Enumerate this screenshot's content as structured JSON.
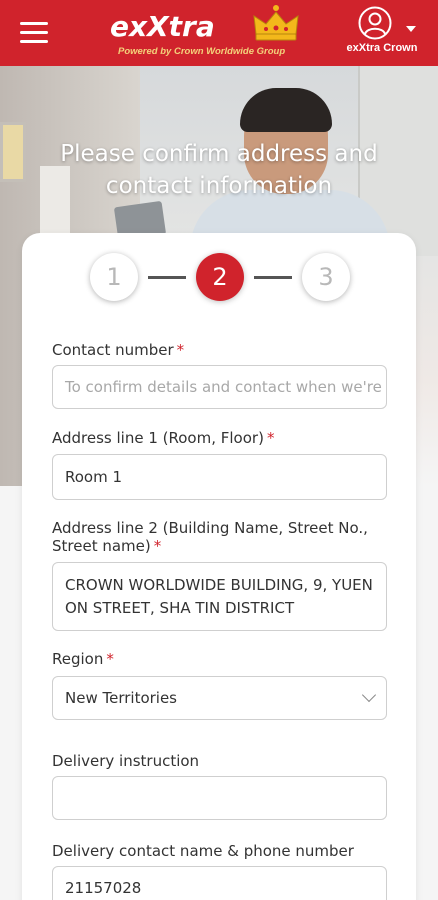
{
  "header": {
    "brand_name": "exXtra",
    "brand_tagline": "Powered by Crown Worldwide Group",
    "user_label": "exXtra Crown",
    "colors": {
      "primary": "#d0232c",
      "crown": "#f3b81b"
    }
  },
  "hero": {
    "title": "Please confirm address and contact information"
  },
  "stepper": {
    "steps": [
      "1",
      "2",
      "3"
    ],
    "current": "2"
  },
  "form": {
    "contact_number": {
      "label": "Contact number",
      "required": "*",
      "placeholder": "To confirm details and contact when we're",
      "value": ""
    },
    "address_line1": {
      "label": "Address line 1 (Room, Floor)",
      "required": "*",
      "value": "Room 1"
    },
    "address_line2": {
      "label_line1": "Address line 2 (Building Name, Street No.,",
      "label_line2": "Street name)",
      "required": "*",
      "value": "CROWN WORLDWIDE BUILDING, 9, YUEN ON STREET, SHA TIN DISTRICT"
    },
    "region": {
      "label": "Region",
      "required": "*",
      "value": "New Territories"
    },
    "delivery_instruction": {
      "label": "Delivery instruction",
      "value": ""
    },
    "delivery_contact": {
      "label": "Delivery contact name & phone number",
      "value": "21157028"
    }
  }
}
